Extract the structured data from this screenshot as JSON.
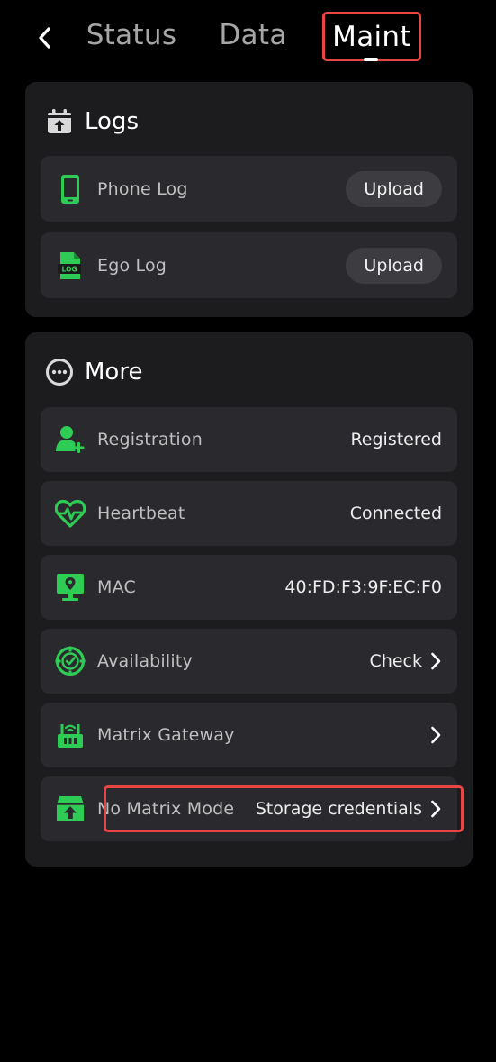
{
  "header": {
    "back_icon": "chevron-left-icon",
    "tabs": [
      {
        "label": "Status"
      },
      {
        "label": "Data"
      },
      {
        "label": "Maint"
      }
    ],
    "active_tab": "Maint",
    "highlight_color": "#e84545"
  },
  "logs": {
    "title": "Logs",
    "icon": "upload-calendar-icon",
    "items": [
      {
        "label": "Phone Log",
        "icon": "phone-icon",
        "button": "Upload"
      },
      {
        "label": "Ego Log",
        "icon": "log-file-icon",
        "button": "Upload"
      }
    ]
  },
  "more": {
    "title": "More",
    "icon": "more-dots-icon",
    "items": [
      {
        "label": "Registration",
        "icon": "add-user-icon",
        "value": "Registered"
      },
      {
        "label": "Heartbeat",
        "icon": "heartbeat-icon",
        "value": "Connected"
      },
      {
        "label": "MAC",
        "icon": "monitor-pin-icon",
        "value": "40:FD:F3:9F:EC:F0"
      },
      {
        "label": "Availability",
        "icon": "availability-icon",
        "value": "Check"
      },
      {
        "label": "Matrix Gateway",
        "icon": "router-icon",
        "value": ""
      },
      {
        "label": "No Matrix Mode",
        "icon": "storage-upload-icon",
        "value": "Storage credentials"
      }
    ]
  },
  "colors": {
    "accent": "#2ecc55",
    "background": "#000000",
    "card": "#1c1c1f",
    "row": "#2a2a2e"
  }
}
